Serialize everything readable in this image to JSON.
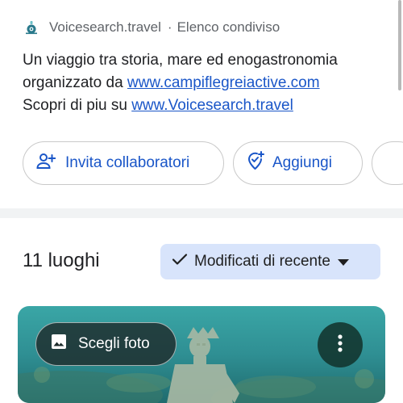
{
  "source": {
    "site": "Voicesearch.travel",
    "separator": "·",
    "list_type": "Elenco condiviso",
    "icon": "voicesearch-logo-icon"
  },
  "description": {
    "line1": "Un viaggio tra storia, mare ed enogastronomia",
    "line2_prefix": "organizzato da ",
    "line2_link": "www.campiflegreiactive.com",
    "line3_prefix": "Scopri di piu su ",
    "line3_link": "www.Voicesearch.travel"
  },
  "actions": {
    "invite_label": "Invita collaboratori",
    "invite_icon": "add-person-icon",
    "add_label": "Aggiungi",
    "add_icon": "add-location-icon"
  },
  "places": {
    "count_label": "11 luoghi",
    "sort_label": "Modificati di recente",
    "sort_check_icon": "check-icon",
    "sort_caret_icon": "dropdown-caret-icon"
  },
  "photo": {
    "choose_label": "Scegli foto",
    "choose_icon": "image-icon",
    "more_icon": "more-vertical-icon"
  },
  "colors": {
    "link": "#1a56c8",
    "chip_bg": "#d8e4fb",
    "water": "#2f8f93"
  }
}
